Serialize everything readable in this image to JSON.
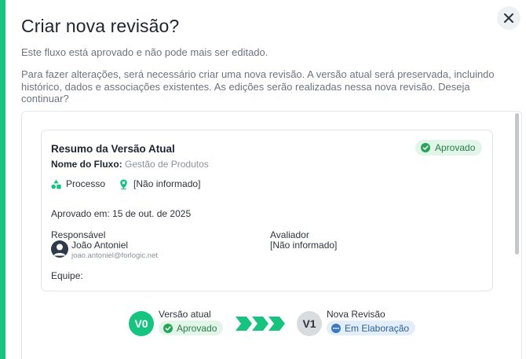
{
  "dialog": {
    "title": "Criar nova revisão?",
    "subtitle": "Este fluxo está aprovado e não pode mais ser editado.",
    "description": "Para fazer alterações, será necessário criar uma nova revisão. A versão atual será preservada, incluindo histórico, dados e associações existentes. As edições serão realizadas nessa nova revisão. Deseja continuar?"
  },
  "summary": {
    "title": "Resumo da Versão Atual",
    "status_badge": "Aprovado",
    "flow_name_label": "Nome do Fluxo:",
    "flow_name_value": "Gestão de Produtos",
    "type": "Processo",
    "location": "[Não informado]",
    "approved_on": "Aprovado em: 15 de out. de 2025",
    "responsible_label": "Responsável",
    "responsible_name": "João Antoniel",
    "responsible_email": "joao.antoniel@forlogic.net",
    "evaluator_label": "Avaliador",
    "evaluator_value": "[Não informado]",
    "team_label": "Equipe:"
  },
  "versions": {
    "current": {
      "code": "V0",
      "label": "Versão atual",
      "status": "Aprovado"
    },
    "next": {
      "code": "V1",
      "label": "Nova Revisão",
      "status": "Em Elaboração"
    }
  },
  "colors": {
    "accent": "#16c47f",
    "approved_bg": "#e1f5e8",
    "approved_text": "#2b7a47",
    "draft_bg": "#e3eefb",
    "draft_text": "#2f5f96"
  },
  "icons": [
    "close-icon",
    "check-circle-icon",
    "process-shapes-icon",
    "location-pin-icon",
    "user-avatar-icon",
    "chevron-arrows-icon",
    "ellipsis-circle-icon"
  ]
}
